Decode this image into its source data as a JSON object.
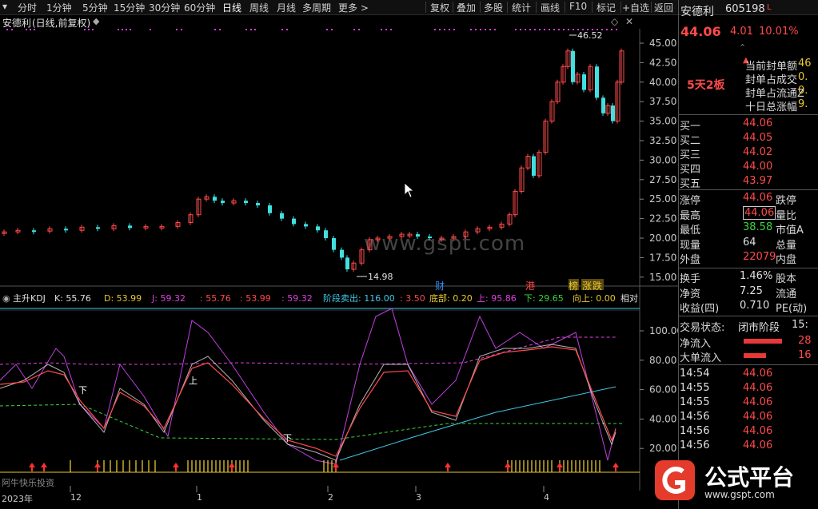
{
  "toolbar": {
    "periods": [
      "分时",
      "1分钟",
      "5分钟",
      "15分钟",
      "30分钟",
      "60分钟",
      "日线",
      "周线",
      "月线",
      "多周期",
      "更多 >"
    ],
    "active_period": "日线",
    "actions": [
      "复权",
      "叠加",
      "多股",
      "统计",
      "画线",
      "F10",
      "标记",
      "+自选",
      "返回"
    ]
  },
  "chart_title": {
    "name": "安德利",
    "mode": "(日线,前复权)",
    "settings_icon": "diamond-settings-icon"
  },
  "price_chart": {
    "y_ticks": [
      "45.00",
      "42.50",
      "40.00",
      "37.50",
      "35.00",
      "32.50",
      "30.00",
      "27.50",
      "25.00",
      "22.50",
      "20.00",
      "17.50",
      "15.00"
    ],
    "high_label": "46.52",
    "low_label": "14.98",
    "markers": [
      {
        "text": "财",
        "color": "#2e8bff"
      },
      {
        "text": "港",
        "color": "#ff4a4a"
      },
      {
        "text": "榜",
        "color": "#e8c830"
      },
      {
        "text": "涨",
        "color": "#e8c830"
      },
      {
        "text": "跌",
        "color": "#e8c830"
      }
    ],
    "watermark": "www.gspt.com"
  },
  "indicator": {
    "name": "主升KDJ",
    "params": [
      {
        "text": "K: 55.76",
        "color": "#e0e0e0"
      },
      {
        "text": "D: 53.99",
        "color": "#e8c830"
      },
      {
        "text": "J: 59.32",
        "color": "#e040e0"
      },
      {
        "text": ": 55.76",
        "color": "#ff4a4a"
      },
      {
        "text": ": 53.99",
        "color": "#ff4a4a"
      },
      {
        "text": ": 59.32",
        "color": "#e040e0"
      },
      {
        "text": "阶段卖出: 116.00",
        "color": "#40c8e8"
      },
      {
        "text": ": 3.50",
        "color": "#ff4a4a"
      },
      {
        "text": "底部: 0.20",
        "color": "#e8c830"
      },
      {
        "text": "上: 95.86",
        "color": "#e040e0"
      },
      {
        "text": "下: 29.65",
        "color": "#3cd43c"
      },
      {
        "text": "向上: 0.00",
        "color": "#e8c830"
      },
      {
        "text": "相对",
        "color": "#e0e0e0"
      }
    ],
    "y_ticks": [
      "100.00",
      "80.00",
      "60.00",
      "40.00",
      "20.00"
    ],
    "labels": {
      "up": "上",
      "down": "下"
    }
  },
  "x_axis": {
    "labels": [
      "2023年",
      "12",
      "1",
      "2",
      "3",
      "4"
    ],
    "bottom_left": "阿牛快乐投资"
  },
  "stock": {
    "name": "安德利",
    "code": "605198",
    "suffix": "L",
    "price": "44.06",
    "change": "4.01",
    "change_pct": "10.01%",
    "limit_tag": "5天2板",
    "fields": [
      {
        "label": "当前封单额",
        "value": "46"
      },
      {
        "label": "封单占成交",
        "value": "0."
      },
      {
        "label": "封单占流通Z",
        "value": "0."
      },
      {
        "label": "十日总涨幅",
        "value": "9."
      }
    ],
    "bids": [
      {
        "label": "买一",
        "price": "44.06"
      },
      {
        "label": "买二",
        "price": "44.05"
      },
      {
        "label": "买三",
        "price": "44.02"
      },
      {
        "label": "买四",
        "price": "44.00"
      },
      {
        "label": "买五",
        "price": "43.97"
      }
    ],
    "quote": [
      {
        "l1": "涨停",
        "v1": "44.06",
        "c1": "red",
        "l2": "跌停"
      },
      {
        "l1": "最高",
        "v1": "44.06",
        "c1": "red",
        "l2": "量比",
        "boxed": true
      },
      {
        "l1": "最低",
        "v1": "38.58",
        "c1": "green",
        "l2": "市值A"
      },
      {
        "l1": "现量",
        "v1": "64",
        "c1": "white",
        "l2": "总量"
      },
      {
        "l1": "外盘",
        "v1": "22079",
        "c1": "red",
        "l2": "内盘"
      }
    ],
    "stats": [
      {
        "l1": "换手",
        "v1": "1.46%",
        "l2": "股本"
      },
      {
        "l1": "净资",
        "v1": "7.25",
        "l2": "流通"
      },
      {
        "l1": "收益(四)",
        "v1": "0.710",
        "l2": "PE(动)"
      }
    ],
    "status_label": "交易状态:",
    "status_value": "闭市阶段",
    "status_time": "15:",
    "flows": [
      {
        "label": "净流入",
        "value": "28"
      },
      {
        "label": "大单流入",
        "value": "16"
      }
    ],
    "ticks": [
      {
        "time": "14:54",
        "price": "44.06"
      },
      {
        "time": "14:55",
        "price": "44.06"
      },
      {
        "time": "14:55",
        "price": "44.06"
      },
      {
        "time": "14:56",
        "price": "44.06"
      },
      {
        "time": "14:56",
        "price": "44.06"
      },
      {
        "time": "14:56",
        "price": "44.06"
      }
    ]
  },
  "brand": {
    "name": "公式平台",
    "url": "www.gspt.com"
  }
}
